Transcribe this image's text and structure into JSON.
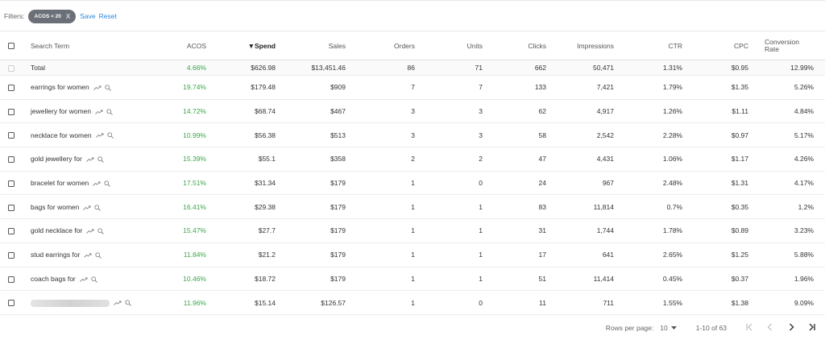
{
  "filters": {
    "label": "Filters:",
    "chip_label": "ACOS < 20",
    "chip_close": "X",
    "save_label": "Save",
    "reset_label": "Reset"
  },
  "columns": {
    "term": "Search Term",
    "acos": "ACOS",
    "spend_arrow": "▼",
    "spend": "Spend",
    "sales": "Sales",
    "orders": "Orders",
    "units": "Units",
    "clicks": "Clicks",
    "impressions": "Impressions",
    "ctr": "CTR",
    "cpc": "CPC",
    "conversion_line1": "Conversion",
    "conversion_line2": "Rate"
  },
  "total": {
    "term": "Total",
    "acos": "4.66%",
    "spend": "$626.98",
    "sales": "$13,451.46",
    "orders": "86",
    "units": "71",
    "clicks": "662",
    "impressions": "50,471",
    "ctr": "1.31%",
    "cpc": "$0.95",
    "conversion": "12.99%"
  },
  "rows": [
    {
      "term": "earrings for women",
      "acos": "19.74%",
      "spend": "$179.48",
      "sales": "$909",
      "orders": "7",
      "units": "7",
      "clicks": "133",
      "impressions": "7,421",
      "ctr": "1.79%",
      "cpc": "$1.35",
      "conversion": "5.26%"
    },
    {
      "term": "jewellery for women",
      "acos": "14.72%",
      "spend": "$68.74",
      "sales": "$467",
      "orders": "3",
      "units": "3",
      "clicks": "62",
      "impressions": "4,917",
      "ctr": "1.26%",
      "cpc": "$1.11",
      "conversion": "4.84%"
    },
    {
      "term": "necklace for women",
      "acos": "10.99%",
      "spend": "$56.38",
      "sales": "$513",
      "orders": "3",
      "units": "3",
      "clicks": "58",
      "impressions": "2,542",
      "ctr": "2.28%",
      "cpc": "$0.97",
      "conversion": "5.17%"
    },
    {
      "term": "gold jewellery for",
      "acos": "15.39%",
      "spend": "$55.1",
      "sales": "$358",
      "orders": "2",
      "units": "2",
      "clicks": "47",
      "impressions": "4,431",
      "ctr": "1.06%",
      "cpc": "$1.17",
      "conversion": "4.26%"
    },
    {
      "term": "bracelet for women",
      "acos": "17.51%",
      "spend": "$31.34",
      "sales": "$179",
      "orders": "1",
      "units": "0",
      "clicks": "24",
      "impressions": "967",
      "ctr": "2.48%",
      "cpc": "$1.31",
      "conversion": "4.17%"
    },
    {
      "term": "bags for women",
      "acos": "16.41%",
      "spend": "$29.38",
      "sales": "$179",
      "orders": "1",
      "units": "1",
      "clicks": "83",
      "impressions": "11,814",
      "ctr": "0.7%",
      "cpc": "$0.35",
      "conversion": "1.2%"
    },
    {
      "term": "gold necklace for",
      "acos": "15.47%",
      "spend": "$27.7",
      "sales": "$179",
      "orders": "1",
      "units": "1",
      "clicks": "31",
      "impressions": "1,744",
      "ctr": "1.78%",
      "cpc": "$0.89",
      "conversion": "3.23%"
    },
    {
      "term": "stud earrings for",
      "acos": "11.84%",
      "spend": "$21.2",
      "sales": "$179",
      "orders": "1",
      "units": "1",
      "clicks": "17",
      "impressions": "641",
      "ctr": "2.65%",
      "cpc": "$1.25",
      "conversion": "5.88%"
    },
    {
      "term": "coach bags for",
      "acos": "10.46%",
      "spend": "$18.72",
      "sales": "$179",
      "orders": "1",
      "units": "1",
      "clicks": "51",
      "impressions": "11,414",
      "ctr": "0.45%",
      "cpc": "$0.37",
      "conversion": "1.96%"
    },
    {
      "term": "",
      "acos": "11.96%",
      "spend": "$15.14",
      "sales": "$126.57",
      "orders": "1",
      "units": "0",
      "clicks": "11",
      "impressions": "711",
      "ctr": "1.55%",
      "cpc": "$1.38",
      "conversion": "9.09%"
    }
  ],
  "pagination": {
    "rows_per_page_label": "Rows per page:",
    "rows_per_page_value": "10",
    "range": "1-10 of 63",
    "first_icon": "first-page-icon",
    "prev_icon": "chevron-left-icon",
    "next_icon": "chevron-right-icon",
    "last_icon": "last-page-icon"
  },
  "colors": {
    "acos_green": "#3aa64a",
    "link_blue": "#2b86d9",
    "chip_bg": "#6b7078"
  }
}
